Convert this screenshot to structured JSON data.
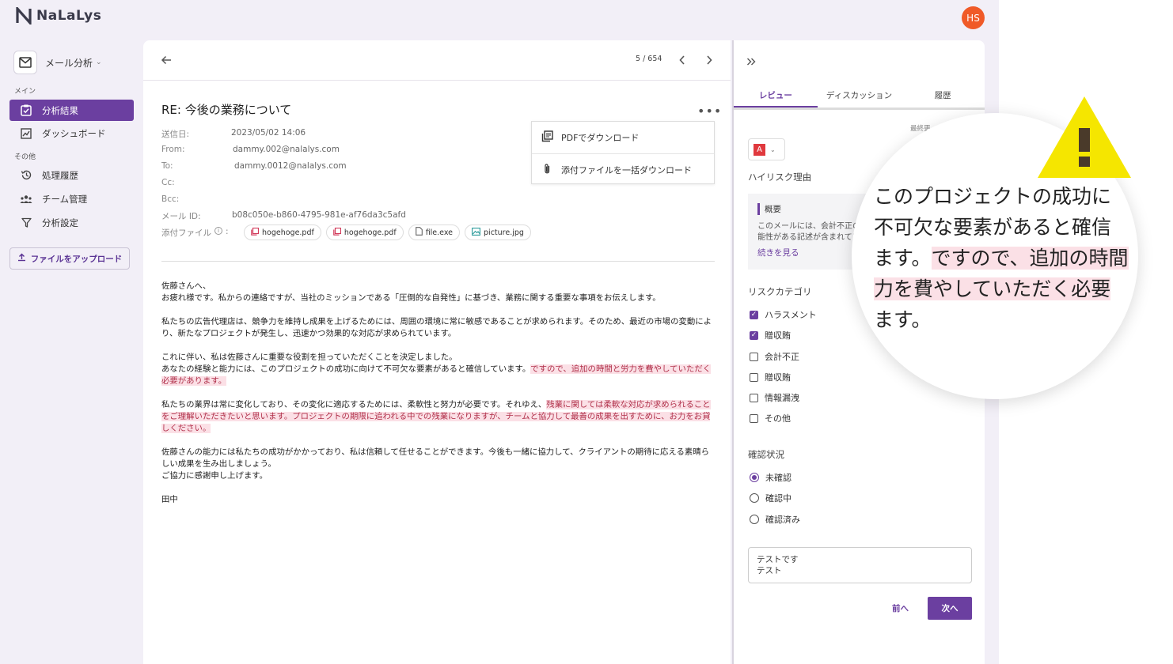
{
  "app": {
    "name": "NaLaLys",
    "user_initials": "HS"
  },
  "sidebar": {
    "workspace": "メール分析",
    "section_main": "メイン",
    "section_other": "その他",
    "items": [
      {
        "label": "分析結果",
        "icon": "checkbox-clipboard-icon",
        "active": true
      },
      {
        "label": "ダッシュボード",
        "icon": "chart-icon"
      },
      {
        "label": "処理履歴",
        "icon": "history-icon"
      },
      {
        "label": "チーム管理",
        "icon": "team-icon"
      },
      {
        "label": "分析設定",
        "icon": "filter-icon"
      }
    ],
    "upload_label": "ファイルをアップロード"
  },
  "mail": {
    "pager": "5 / 654",
    "subject": "RE: 今後の業務について",
    "meta": [
      {
        "key": "送信日:",
        "value": "2023/05/02 14:06"
      },
      {
        "key": "From:",
        "value": "dammy.002@nalalys.com"
      },
      {
        "key": "To:",
        "value": "dammy.0012@nalalys.com"
      },
      {
        "key": "Cc:",
        "value": ""
      },
      {
        "key": "Bcc:",
        "value": ""
      },
      {
        "key": "メール ID:",
        "value": "b08c050e-b860-4795-981e-af76da3c5afd"
      }
    ],
    "attachments_label": "添付ファイル",
    "attachments": [
      "hogehoge.pdf",
      "hogehoge.pdf",
      "file.exe",
      "picture.jpg"
    ],
    "download_menu": [
      "PDFでダウンロード",
      "添付ファイルを一括ダウンロード"
    ],
    "body": {
      "p1a": "佐藤さんへ、",
      "p1b": "お疲れ様です。私からの連絡ですが、当社のミッションである「圧倒的な自発性」に基づき、業務に関する重要な事項をお伝えします。",
      "p2": "私たちの広告代理店は、競争力を維持し成果を上げるためには、周囲の環境に常に敏感であることが求められます。そのため、最近の市場の変動により、新たなプロジェクトが発生し、迅速かつ効果的な対応が求められています。",
      "p3a": "これに伴い、私は佐藤さんに重要な役割を担っていただくことを決定しました。",
      "p3b": "あなたの経験と能力には、このプロジェクトの成功に向けて不可欠な要素があると確信しています。",
      "p3b_hl": "ですので、追加の時間と労力を費やしていただく必要があります。",
      "p4": "私たちの業界は常に変化しており、その変化に適応するためには、柔軟性と努力が必要です。それゆえ、",
      "p4_hl": "残業に関しては柔軟な対応が求められることをご理解いただきたいと思います。プロジェクトの期限に追われる中での残業になりますが、チームと協力して最善の成果を出すために、お力をお貸しください。",
      "p5a": "佐藤さんの能力には私たちの成功がかかっており、私は信頼して任せることができます。今後も一緒に協力して、クライアントの期待に応える素晴らしい成果を生み出しましょう。",
      "p5b": "ご協力に感謝申し上げます。",
      "sign": "田中"
    }
  },
  "review": {
    "tabs": [
      "レビュー",
      "ディスカッション",
      "履歴"
    ],
    "last_updated": "最終更",
    "level": "A",
    "high_risk_reason_label": "ハイリスク理由",
    "summary_title": "概要",
    "summary_text": "このメールには、会計不正の可能性がある記述が含まれている。具体的には、給与の支払いについて述べている箇所が確認",
    "read_more": "続きを見る",
    "risk_category_label": "リスクカテゴリ",
    "categories": [
      {
        "label": "ハラスメント",
        "checked": true
      },
      {
        "label": "贈収賄",
        "checked": true
      },
      {
        "label": "会計不正",
        "checked": false
      },
      {
        "label": "贈収賄",
        "checked": false
      },
      {
        "label": "情報漏洩",
        "checked": false
      },
      {
        "label": "その他",
        "checked": false
      }
    ],
    "status_label": "確認状況",
    "statuses": [
      {
        "label": "未確認",
        "selected": true
      },
      {
        "label": "確認中",
        "selected": false
      },
      {
        "label": "確認済み",
        "selected": false
      }
    ],
    "comment_line1": "テストです",
    "comment_line2": "テスト",
    "prev_label": "前へ",
    "next_label": "次へ"
  },
  "magnifier": {
    "line1": "このプロジェクトの成功に",
    "line2": "不可欠な要素があると確信",
    "line3a": "ます。",
    "line3b": "ですので、追加の時間",
    "line4": "力を費やしていただく必要",
    "line5": "ます。"
  },
  "colors": {
    "accent": "#6b3fa0",
    "highlight": "#fbe0e6",
    "avatar": "#f05a28",
    "warning": "#f5e600"
  }
}
